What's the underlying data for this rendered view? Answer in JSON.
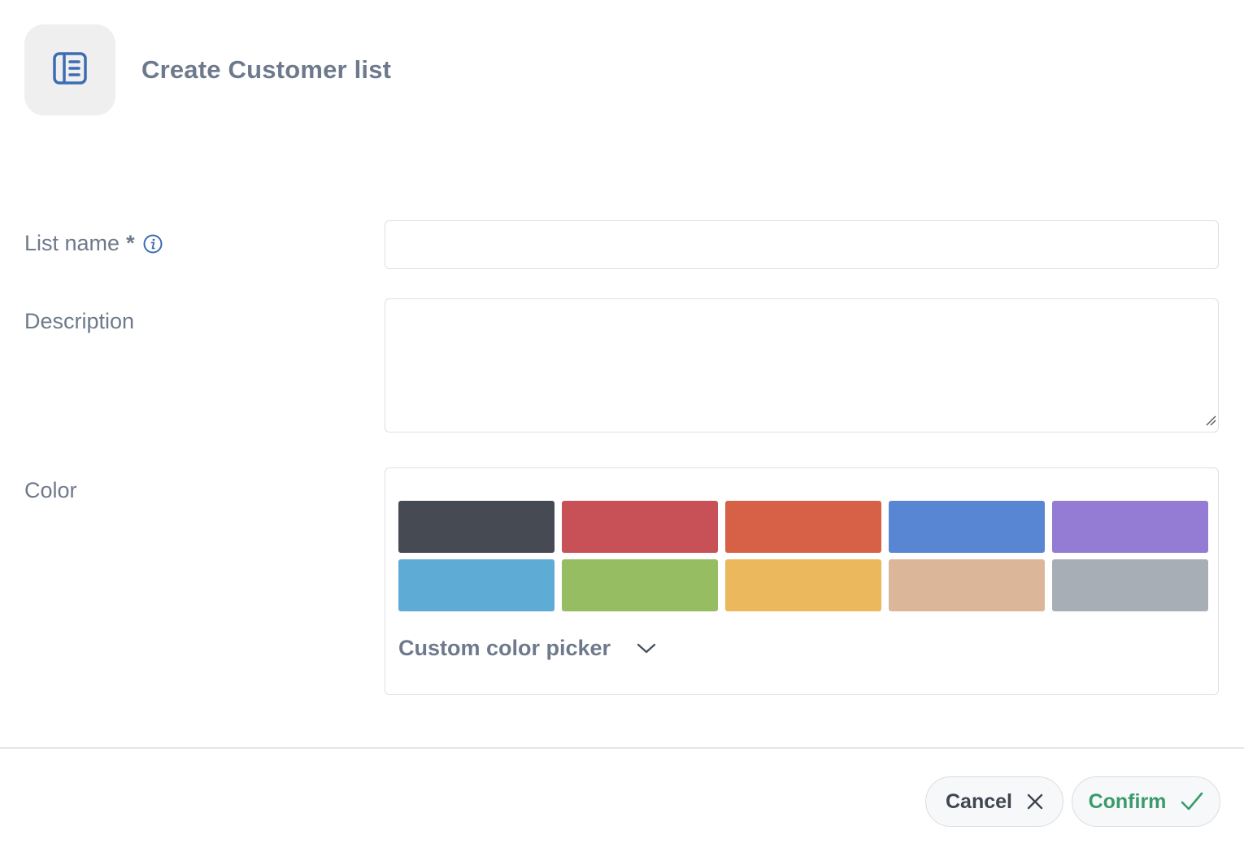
{
  "header": {
    "icon": "list-icon",
    "title": "Create Customer list"
  },
  "form": {
    "list_name": {
      "label": "List name",
      "required_marker": "*",
      "info_icon": "info-icon",
      "value": ""
    },
    "description": {
      "label": "Description",
      "value": ""
    },
    "color": {
      "label": "Color",
      "swatches": [
        "#464a52",
        "#c85057",
        "#d66147",
        "#5886d2",
        "#947bd4",
        "#5eacd5",
        "#96bd62",
        "#ebb85e",
        "#dcb698",
        "#a8aeb6"
      ],
      "custom_picker_label": "Custom color picker",
      "custom_picker_icon": "chevron-down-icon"
    }
  },
  "footer": {
    "cancel_label": "Cancel",
    "cancel_icon": "close-icon",
    "confirm_label": "Confirm",
    "confirm_icon": "check-icon"
  },
  "colors": {
    "accent_blue": "#3c6db3",
    "confirm_green": "#3a9a6b",
    "text_muted": "#6e7a8c"
  }
}
